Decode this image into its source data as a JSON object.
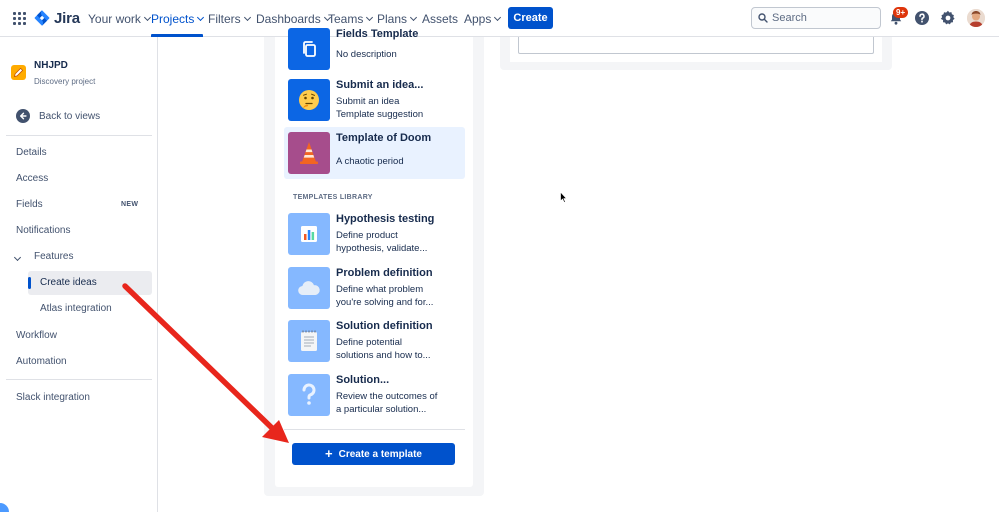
{
  "topnav": {
    "logo_text": "Jira",
    "items": [
      {
        "label": "Your work"
      },
      {
        "label": "Projects"
      },
      {
        "label": "Filters"
      },
      {
        "label": "Dashboards"
      },
      {
        "label": "Teams"
      },
      {
        "label": "Plans"
      },
      {
        "label": "Assets"
      },
      {
        "label": "Apps"
      }
    ],
    "active_item": "Projects",
    "create_label": "Create",
    "search_placeholder": "Search",
    "notification_badge": "9+",
    "accent_color": "#0052CC"
  },
  "sidebar": {
    "project_name": "NHJPD",
    "project_type": "Discovery project",
    "back_label": "Back to views",
    "items": [
      {
        "label": "Details"
      },
      {
        "label": "Access"
      },
      {
        "label": "Fields",
        "tag": "NEW"
      },
      {
        "label": "Notifications"
      },
      {
        "label": "Features"
      },
      {
        "label": "Create ideas"
      },
      {
        "label": "Atlas integration"
      },
      {
        "label": "Workflow"
      },
      {
        "label": "Automation"
      },
      {
        "label": "Slack integration"
      }
    ],
    "selected_item": "Create ideas"
  },
  "templates": {
    "project_templates": [
      {
        "title": "Fields Template",
        "desc": [
          "No description"
        ],
        "icon": "copy-icon"
      },
      {
        "title": "Submit an idea...",
        "desc": [
          "Submit an idea",
          "Template suggestion"
        ],
        "icon": "thinking-face-icon"
      },
      {
        "title": "Template of Doom",
        "desc": [
          "A chaotic period"
        ],
        "icon": "traffic-cone-icon"
      }
    ],
    "selected_template": "Template of Doom",
    "library_heading": "TEMPLATES LIBRARY",
    "library": [
      {
        "title": "Hypothesis testing",
        "desc": [
          "Define product",
          "hypothesis, validate..."
        ],
        "icon": "bar-chart-icon"
      },
      {
        "title": "Problem definition",
        "desc": [
          "Define what problem",
          "you're solving and for..."
        ],
        "icon": "cloud-icon"
      },
      {
        "title": "Solution definition",
        "desc": [
          "Define potential",
          "solutions and how to..."
        ],
        "icon": "notepad-icon"
      },
      {
        "title": "Solution...",
        "desc": [
          "Review the outcomes of",
          "a particular solution..."
        ],
        "icon": "question-mark-icon"
      }
    ],
    "create_button_label": "Create a template"
  },
  "annotation": {
    "arrow_color": "#E8261C"
  }
}
